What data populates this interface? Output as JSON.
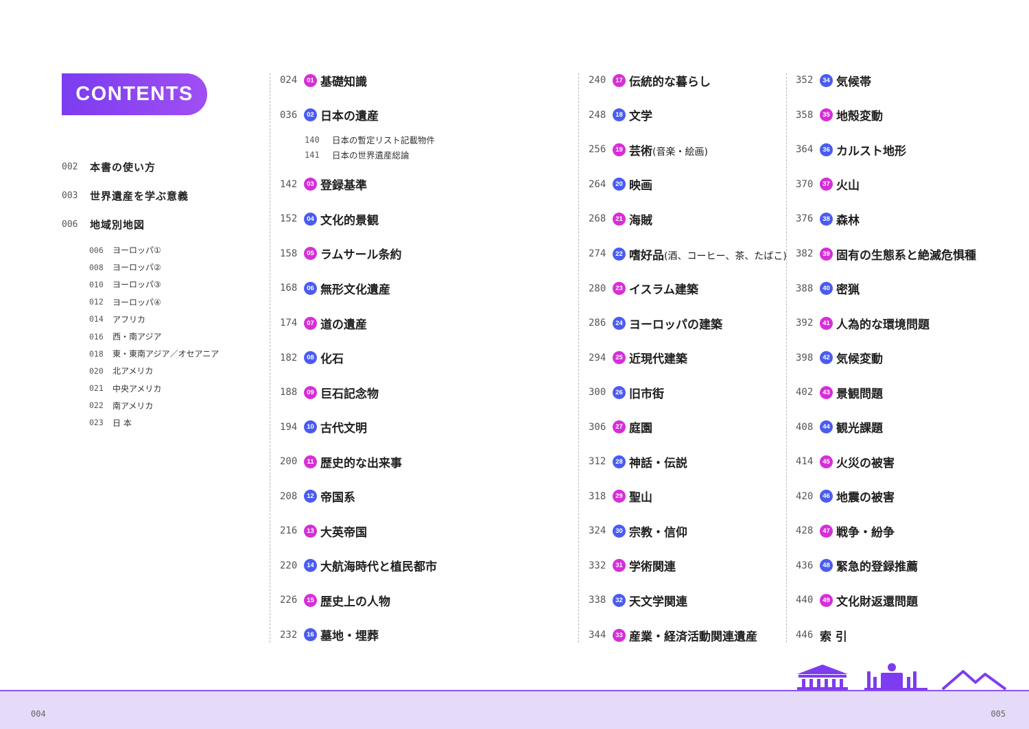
{
  "badge": "CONTENTS",
  "left_items": [
    {
      "page": "002",
      "label": "本書の使い方"
    },
    {
      "page": "003",
      "label": "世界遺産を学ぶ意義"
    },
    {
      "page": "006",
      "label": "地域別地図"
    }
  ],
  "map_subitems": [
    {
      "page": "006",
      "label": "ヨーロッパ①"
    },
    {
      "page": "008",
      "label": "ヨーロッパ②"
    },
    {
      "page": "010",
      "label": "ヨーロッパ③"
    },
    {
      "page": "012",
      "label": "ヨーロッパ④"
    },
    {
      "page": "014",
      "label": "アフリカ"
    },
    {
      "page": "016",
      "label": "西・南アジア"
    },
    {
      "page": "018",
      "label": "東・東南アジア／オセアニア"
    },
    {
      "page": "020",
      "label": "北アメリカ"
    },
    {
      "page": "021",
      "label": "中央アメリカ"
    },
    {
      "page": "022",
      "label": "南アメリカ"
    },
    {
      "page": "023",
      "label": "日 本"
    }
  ],
  "col1": [
    {
      "page": "024",
      "num": "01",
      "label": "基礎知識"
    },
    {
      "page": "036",
      "num": "02",
      "label": "日本の遺産",
      "subs": [
        {
          "page": "140",
          "label": "日本の暫定リスト記載物件"
        },
        {
          "page": "141",
          "label": "日本の世界遺産総論"
        }
      ]
    },
    {
      "page": "142",
      "num": "03",
      "label": "登録基準"
    },
    {
      "page": "152",
      "num": "04",
      "label": "文化的景観"
    },
    {
      "page": "158",
      "num": "05",
      "label": "ラムサール条約"
    },
    {
      "page": "168",
      "num": "06",
      "label": "無形文化遺産"
    },
    {
      "page": "174",
      "num": "07",
      "label": "道の遺産"
    },
    {
      "page": "182",
      "num": "08",
      "label": "化石"
    },
    {
      "page": "188",
      "num": "09",
      "label": "巨石記念物"
    },
    {
      "page": "194",
      "num": "10",
      "label": "古代文明"
    },
    {
      "page": "200",
      "num": "11",
      "label": "歴史的な出来事"
    },
    {
      "page": "208",
      "num": "12",
      "label": "帝国系"
    },
    {
      "page": "216",
      "num": "13",
      "label": "大英帝国"
    },
    {
      "page": "220",
      "num": "14",
      "label": "大航海時代と植民都市"
    },
    {
      "page": "226",
      "num": "15",
      "label": "歴史上の人物"
    },
    {
      "page": "232",
      "num": "16",
      "label": "墓地・埋葬"
    }
  ],
  "col2": [
    {
      "page": "240",
      "num": "17",
      "label": "伝統的な暮らし"
    },
    {
      "page": "248",
      "num": "18",
      "label": "文学"
    },
    {
      "page": "256",
      "num": "19",
      "label": "芸術",
      "paren": "(音楽・絵画)"
    },
    {
      "page": "264",
      "num": "20",
      "label": "映画"
    },
    {
      "page": "268",
      "num": "21",
      "label": "海賊"
    },
    {
      "page": "274",
      "num": "22",
      "label": "嗜好品",
      "paren": "(酒、コーヒー、茶、たばこ)"
    },
    {
      "page": "280",
      "num": "23",
      "label": "イスラム建築"
    },
    {
      "page": "286",
      "num": "24",
      "label": "ヨーロッパの建築"
    },
    {
      "page": "294",
      "num": "25",
      "label": "近現代建築"
    },
    {
      "page": "300",
      "num": "26",
      "label": "旧市街"
    },
    {
      "page": "306",
      "num": "27",
      "label": "庭園"
    },
    {
      "page": "312",
      "num": "28",
      "label": "神話・伝説"
    },
    {
      "page": "318",
      "num": "29",
      "label": "聖山"
    },
    {
      "page": "324",
      "num": "30",
      "label": "宗教・信仰"
    },
    {
      "page": "332",
      "num": "31",
      "label": "学術関連"
    },
    {
      "page": "338",
      "num": "32",
      "label": "天文学関連"
    },
    {
      "page": "344",
      "num": "33",
      "label": "産業・経済活動関連遺産"
    }
  ],
  "col3": [
    {
      "page": "352",
      "num": "34",
      "label": "気候帯"
    },
    {
      "page": "358",
      "num": "35",
      "label": "地殻変動"
    },
    {
      "page": "364",
      "num": "36",
      "label": "カルスト地形"
    },
    {
      "page": "370",
      "num": "37",
      "label": "火山"
    },
    {
      "page": "376",
      "num": "38",
      "label": "森林"
    },
    {
      "page": "382",
      "num": "39",
      "label": "固有の生態系と絶滅危惧種"
    },
    {
      "page": "388",
      "num": "40",
      "label": "密猟"
    },
    {
      "page": "392",
      "num": "41",
      "label": "人為的な環境問題"
    },
    {
      "page": "398",
      "num": "42",
      "label": "気候変動"
    },
    {
      "page": "402",
      "num": "43",
      "label": "景観問題"
    },
    {
      "page": "408",
      "num": "44",
      "label": "観光課題"
    },
    {
      "page": "414",
      "num": "45",
      "label": "火災の被害"
    },
    {
      "page": "420",
      "num": "46",
      "label": "地震の被害"
    },
    {
      "page": "428",
      "num": "47",
      "label": "戦争・紛争"
    },
    {
      "page": "436",
      "num": "48",
      "label": "緊急的登録推薦"
    },
    {
      "page": "440",
      "num": "49",
      "label": "文化財返還問題"
    },
    {
      "page": "446",
      "label": "索 引"
    }
  ],
  "folio_left": "004",
  "folio_right": "005",
  "colors": {
    "accent": "#8a50f0",
    "num_blue": "#4a5cf0",
    "num_pink": "#d52fd8",
    "band": "#e5daf8"
  },
  "icons": [
    "temple-icon",
    "cathedral-icon",
    "mountains-icon"
  ]
}
